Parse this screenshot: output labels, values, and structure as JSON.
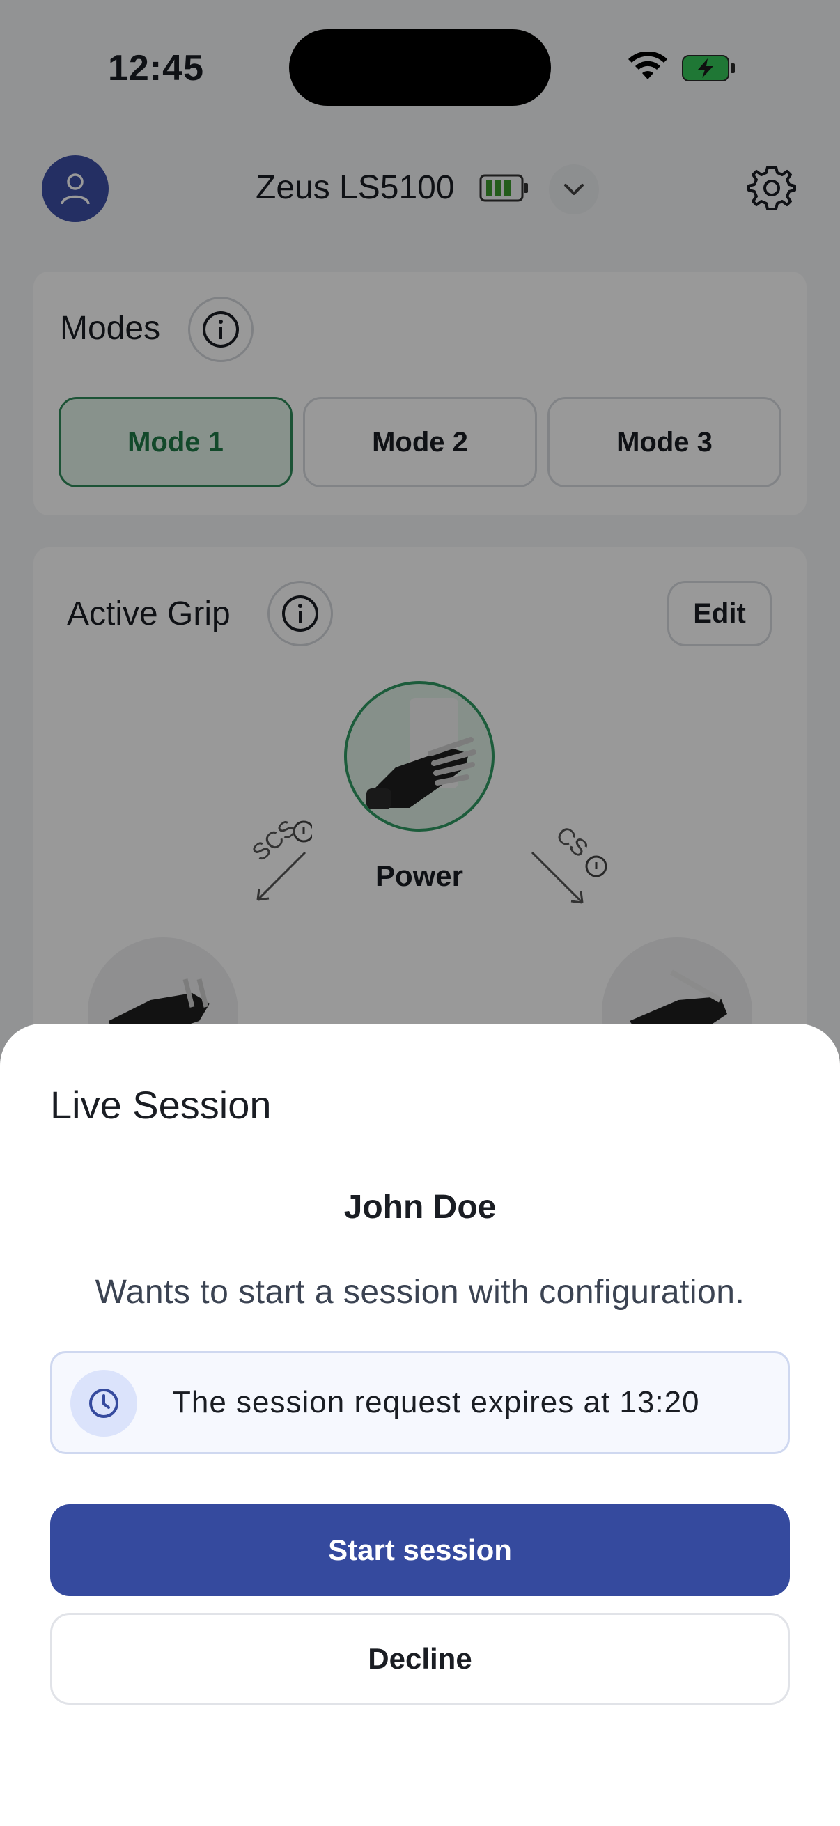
{
  "status_bar": {
    "time": "12:45",
    "icons": [
      "wifi-icon",
      "battery-charging-icon"
    ]
  },
  "header": {
    "device_name": "Zeus LS5100",
    "icons": [
      "user-avatar-icon",
      "battery-icon",
      "chevron-down-icon",
      "gear-icon"
    ]
  },
  "modes": {
    "title": "Modes",
    "items": [
      {
        "label": "Mode 1",
        "active": true
      },
      {
        "label": "Mode 2",
        "active": false
      },
      {
        "label": "Mode 3",
        "active": false
      }
    ]
  },
  "active_grip": {
    "title": "Active Grip",
    "edit_label": "Edit",
    "current_grip": "Power",
    "left_transition": "SCS",
    "right_transition": "CS"
  },
  "sheet": {
    "title": "Live Session",
    "requester": "John Doe",
    "message": "Wants to start a session with configuration.",
    "expiry_text": "The session request expires at 13:20",
    "start_label": "Start session",
    "decline_label": "Decline"
  },
  "colors": {
    "primary": "#354a9e",
    "active_green": "#1f7a47",
    "overlay": "rgba(0,0,0,0.40)"
  }
}
